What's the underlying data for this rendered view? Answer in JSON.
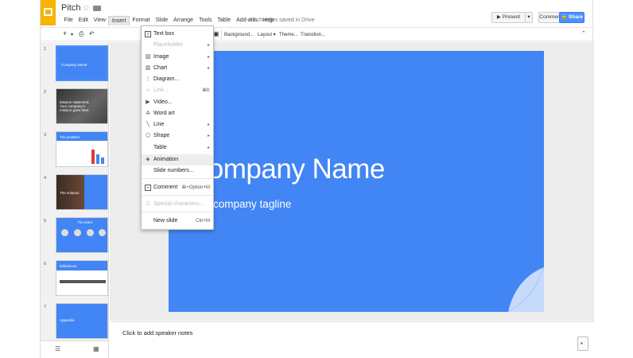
{
  "app": {
    "title": "Pitch",
    "saved_status": "All changes saved in Drive"
  },
  "menubar": [
    "File",
    "Edit",
    "View",
    "Insert",
    "Format",
    "Slide",
    "Arrange",
    "Tools",
    "Table",
    "Add-ons",
    "Help"
  ],
  "header": {
    "present_label": "Present",
    "comments_label": "Comments",
    "share_label": "Share"
  },
  "toolbar": {
    "background_label": "Background...",
    "layout_label": "Layout",
    "theme_label": "Theme...",
    "transition_label": "Transition..."
  },
  "insert_menu": {
    "items": [
      {
        "label": "Text box",
        "icon": "text-box-icon",
        "enabled": true
      },
      {
        "label": "Placeholder",
        "icon": "",
        "enabled": false,
        "submenu": true
      },
      {
        "label": "Image",
        "icon": "image-icon",
        "enabled": true,
        "submenu": true
      },
      {
        "label": "Chart",
        "icon": "chart-icon",
        "enabled": true,
        "submenu": true
      },
      {
        "label": "Diagram...",
        "icon": "diagram-icon",
        "enabled": true
      },
      {
        "label": "Link...",
        "icon": "link-icon",
        "enabled": false,
        "shortcut": "⌘K"
      },
      {
        "label": "Video...",
        "icon": "video-icon",
        "enabled": true
      },
      {
        "label": "Word art",
        "icon": "word-art-icon",
        "enabled": true
      },
      {
        "label": "Line",
        "icon": "line-icon",
        "enabled": true,
        "submenu": true
      },
      {
        "label": "Shape",
        "icon": "shape-icon",
        "enabled": true,
        "submenu": true
      },
      {
        "label": "Table",
        "icon": "",
        "enabled": true,
        "submenu": true
      },
      {
        "label": "Animation",
        "icon": "animation-icon",
        "enabled": true,
        "highlighted": true
      },
      {
        "label": "Slide numbers...",
        "icon": "",
        "enabled": true
      },
      {
        "label": "Comment",
        "icon": "comment-icon",
        "enabled": true,
        "shortcut": "⌘+Option+M"
      },
      {
        "label": "Special characters...",
        "icon": "omega-icon",
        "enabled": false
      },
      {
        "label": "New slide",
        "icon": "",
        "enabled": true,
        "shortcut": "Ctrl+M"
      }
    ]
  },
  "filmstrip": {
    "slides": [
      {
        "number": "1",
        "text": "Company Name"
      },
      {
        "number": "2",
        "text": "Mission statement: Your company's mission goes here"
      },
      {
        "number": "3",
        "text": "The problem"
      },
      {
        "number": "4",
        "text": "The solution"
      },
      {
        "number": "5",
        "text": "The team"
      },
      {
        "number": "6",
        "text": "Milestones"
      },
      {
        "number": "7",
        "text": "Appendix"
      }
    ]
  },
  "slide": {
    "title": "Company Name",
    "subtitle": "Your company tagline"
  },
  "notes": {
    "placeholder": "Click to add speaker notes"
  },
  "colors": {
    "accent": "#4285f4",
    "brand": "#f4b400",
    "share": "#4d90fe"
  }
}
